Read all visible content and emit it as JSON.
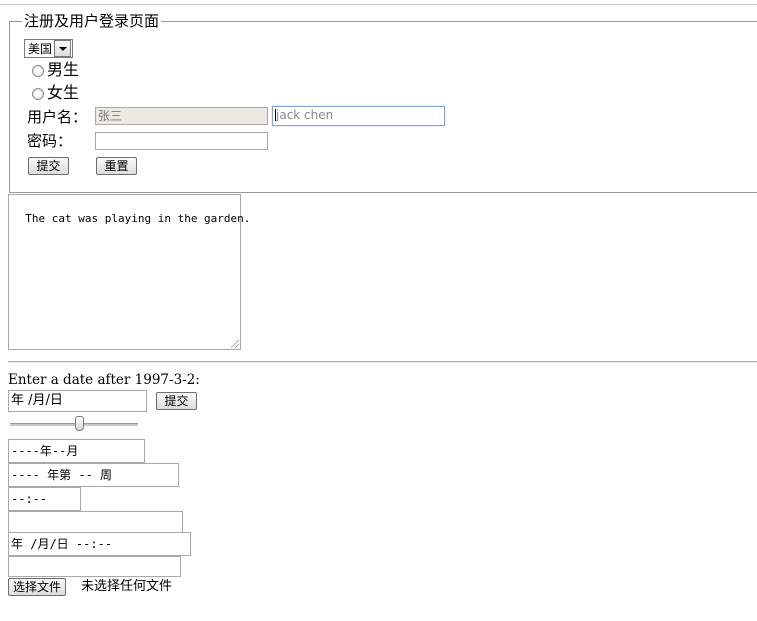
{
  "form": {
    "legend": "注册及用户登录页面",
    "country": {
      "selected": "美国"
    },
    "gender": [
      {
        "label": "男生",
        "checked": false
      },
      {
        "label": "女生",
        "checked": false
      }
    ],
    "username": {
      "label": "用户名：",
      "readonly_value": "张三",
      "input_value": "jack chen"
    },
    "password": {
      "label": "密码：",
      "value": ""
    },
    "submit_label": "提交",
    "reset_label": "重置"
  },
  "textarea": {
    "value": "The cat was playing in the garden."
  },
  "date_section": {
    "label": "Enter a date after 1997-3-2:",
    "date_value": " 年 /月/日",
    "submit_label": "提交",
    "range": {
      "value_fraction": 0.55
    },
    "month_value": "----年--月",
    "week_value": "---- 年第 -- 周",
    "time_value": "--:--",
    "empty1_value": "",
    "datetime_value": " 年 /月/日 --:--",
    "empty2_value": "",
    "file_button_label": "选择文件",
    "file_status": "未选择任何文件"
  },
  "colors": {
    "focus_border": "#7fa3d6",
    "readonly_bg": "#ebe9e1"
  }
}
